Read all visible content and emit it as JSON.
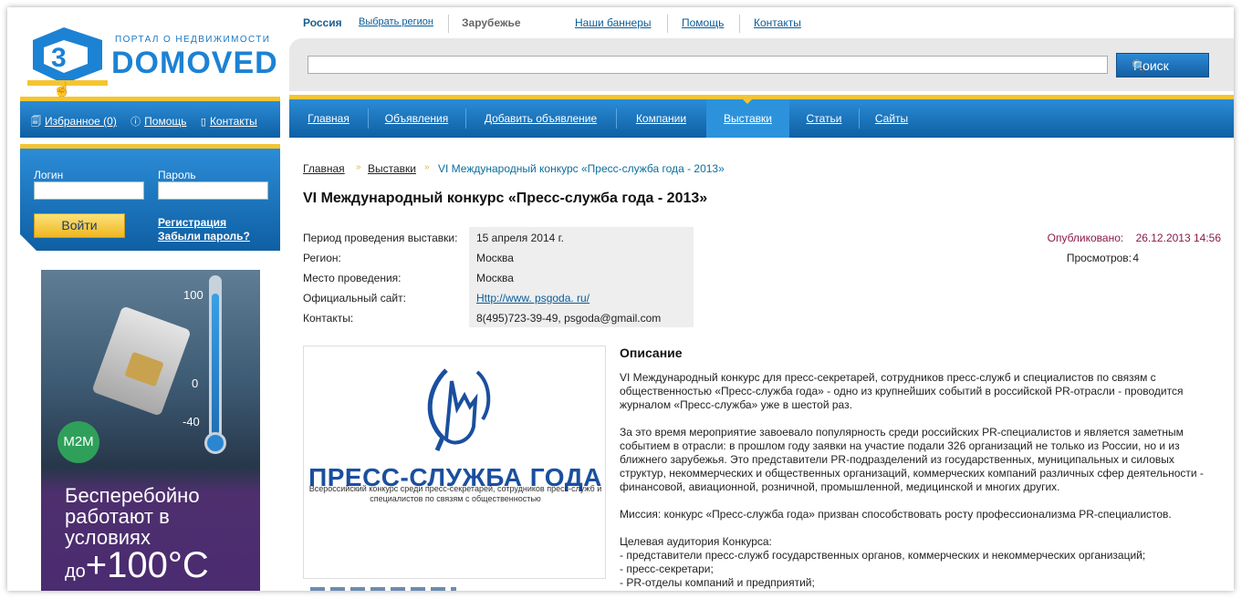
{
  "logo": {
    "tagline": "ПОРТАЛ О НЕДВИЖИМОСТИ",
    "brand": "DOMOVED"
  },
  "toplinks": {
    "russia": "Россия",
    "select_region": "Выбрать регион",
    "abroad": "Зарубежье",
    "banners": "Наши баннеры",
    "help": "Помощь",
    "contacts": "Контакты"
  },
  "search": {
    "value": "",
    "button": "Поиск"
  },
  "leftbar": {
    "favorites": "Избранное (0)",
    "help": "Помощь",
    "contacts": "Контакты"
  },
  "login": {
    "login_label": "Логин",
    "password_label": "Пароль",
    "submit": "Войти",
    "register": "Регистрация",
    "forgot": "Забыли пароль?"
  },
  "ad": {
    "t100": "100",
    "t0": "0",
    "tm40": "-40",
    "badge": "M2M",
    "line1": "Бесперебойно работают в условиях",
    "prefix": "до",
    "big": "+100°C"
  },
  "nav": {
    "items": [
      "Главная",
      "Объявления",
      "Добавить объявление",
      "Компании",
      "Выставки",
      "Статьи",
      "Сайты"
    ],
    "active": "Выставки"
  },
  "breadcrumb": {
    "home": "Главная",
    "section": "Выставки",
    "current": "VI Международный конкурс «Пресс-служба года - 2013»"
  },
  "page": {
    "title": "VI Международный конкурс «Пресс-служба года - 2013»"
  },
  "properties": [
    {
      "key": "Период проведения выставки:",
      "value": "15 апреля 2014 г."
    },
    {
      "key": "Регион:",
      "value": "Москва"
    },
    {
      "key": "Место проведения:",
      "value": "Москва"
    },
    {
      "key": "Официальный сайт:",
      "value": "Http://www. psgoda. ru/"
    },
    {
      "key": "Контакты:",
      "value": "8(495)723-39-49, psgoda@gmail.com"
    }
  ],
  "meta": {
    "published_label": "Опубликовано:",
    "published": "26.12.2013 14:56",
    "views_label": "Просмотров:",
    "views": "4"
  },
  "image": {
    "title": "ПРЕСС-СЛУЖБА ГОДА",
    "subtitle": "Всероссийский конкурс среди пресс-секретарей, сотрудников пресс-служб и специалистов по связям с общественностью"
  },
  "description": {
    "heading": "Описание",
    "p1": "VI Международный конкурс для пресс-секретарей, сотрудников пресс-служб и специалистов по связям с общественностью «Пресс-служба года» - одно из крупнейших событий в российской PR-отрасли - проводится журналом «Пресс-служба» уже в шестой раз.",
    "p2": "За это время мероприятие завоевало популярность среди российских PR-специалистов и является заметным событием в отрасли: в прошлом году заявки на участие подали 326 организаций не только из России, но и из ближнего зарубежья. Это представители PR-подразделений из государственных, муниципальных и силовых структур, некоммерческих и общественных организаций, коммерческих компаний различных сфер деятельности - финансовой, авиационной, розничной, промышленной, медицинской и многих других.",
    "p3": "Миссия: конкурс «Пресс-служба года» призван способствовать росту профессионализма PR-специалистов.",
    "p4_head": "Целевая аудитория Конкурса:",
    "list": [
      "- представители пресс-служб государственных органов, коммерческих и некоммерческих организаций;",
      "- пресс-секретари;",
      "- PR-отделы компаний и предприятий;"
    ]
  },
  "colors": {
    "brand_blue": "#1c82d4",
    "nav_blue": "#0f5fa3",
    "accent_yellow": "#f4c531",
    "published": "#8b1a4a"
  }
}
